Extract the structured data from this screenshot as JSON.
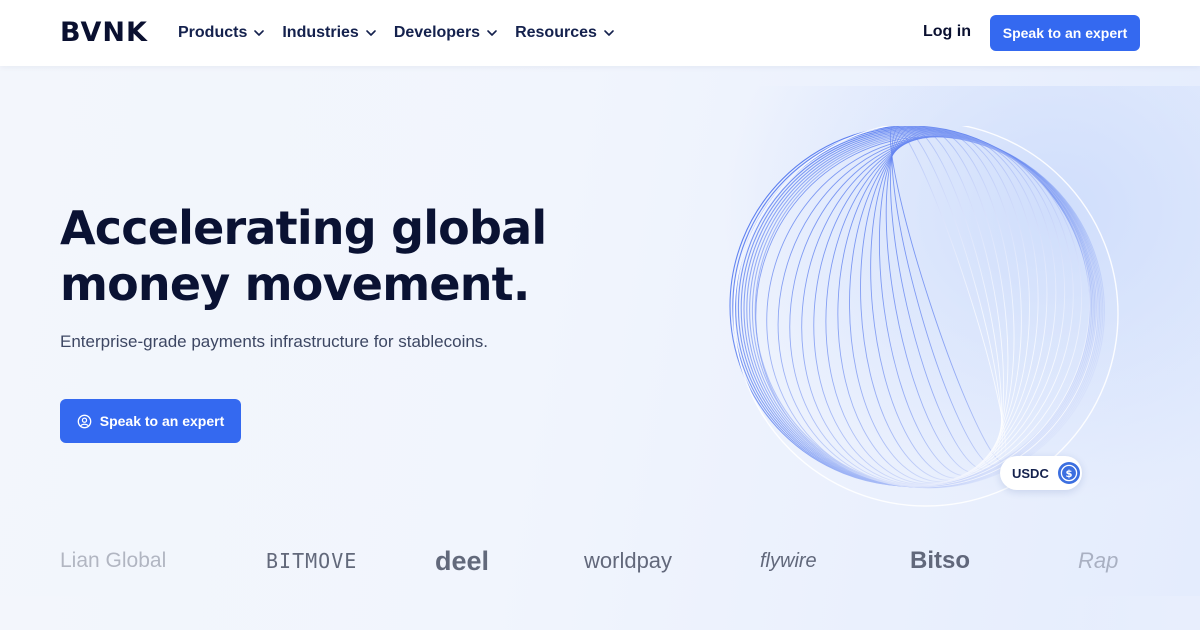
{
  "header": {
    "logo": "BVNK",
    "nav": [
      {
        "label": "Products"
      },
      {
        "label": "Industries"
      },
      {
        "label": "Developers"
      },
      {
        "label": "Resources"
      }
    ],
    "login_label": "Log in",
    "cta_label": "Speak to an expert"
  },
  "hero": {
    "headline_line1": "Accelerating global",
    "headline_line2": "money movement.",
    "subline": "Enterprise-grade payments infrastructure for stablecoins.",
    "cta_label": "Speak to an expert",
    "badge_label": "USDC"
  },
  "logos": [
    "Lian Global",
    "BITMOVE",
    "deel",
    "worldpay",
    "flywire",
    "Bitso",
    "Rap"
  ],
  "colors": {
    "accent": "#3469f0",
    "text_dark": "#0a1233",
    "hero_bg": "#f1f5fd"
  }
}
